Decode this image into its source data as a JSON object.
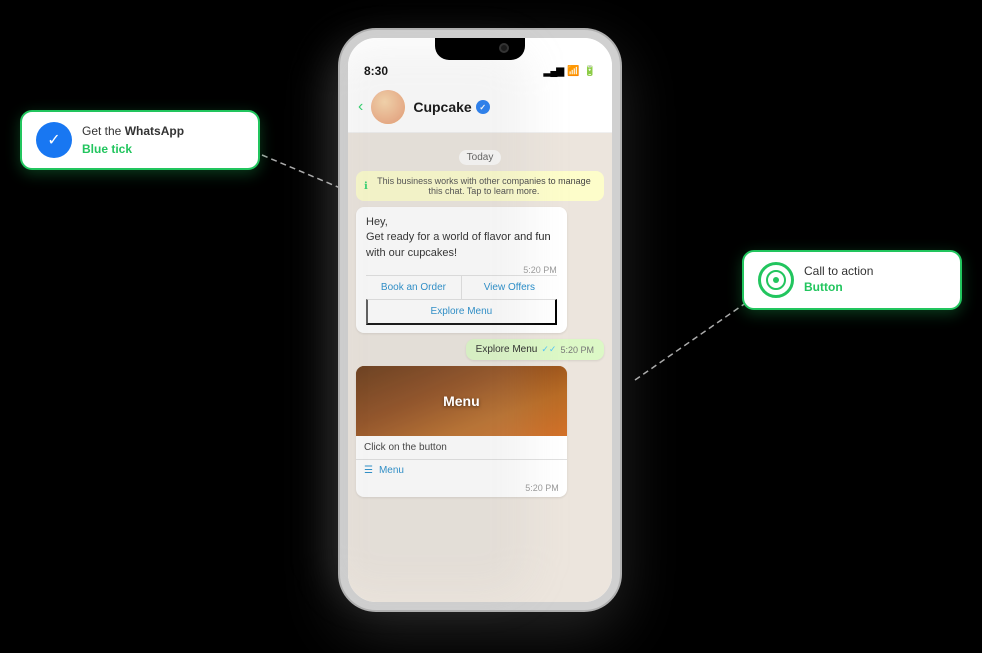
{
  "background": "#000000",
  "phone": {
    "status_time": "8:30",
    "notch": true,
    "chat": {
      "contact_name": "Cupcake",
      "verified": true,
      "date_label": "Today",
      "system_message": "This business works with other companies to manage this chat. Tap to learn more.",
      "bubble_text": "Hey,\nGet ready for a world of flavor and fun with our cupcakes!",
      "bubble_time": "5:20 PM",
      "cta_buttons": [
        "Book an Order",
        "View Offers",
        "Explore Menu"
      ],
      "sent_message": "Explore Menu",
      "sent_time": "5:20 PM",
      "menu_card": {
        "title": "Menu",
        "caption": "Click on the button",
        "btn_label": "Menu",
        "card_time": "5:20 PM"
      }
    }
  },
  "annotation_left": {
    "line1": "Get the ",
    "bold1": "WhatsApp",
    "line2": "Blue tick"
  },
  "annotation_right": {
    "line1": "Call to action",
    "bold1": "Button"
  },
  "icons": {
    "back": "‹",
    "checkmarks": "✓✓",
    "menu_icon": "☰",
    "info": "ℹ",
    "verified_check": "✓",
    "signal_bars": "▂▄▆",
    "wifi": "⊙",
    "battery": "▮▮▮"
  }
}
